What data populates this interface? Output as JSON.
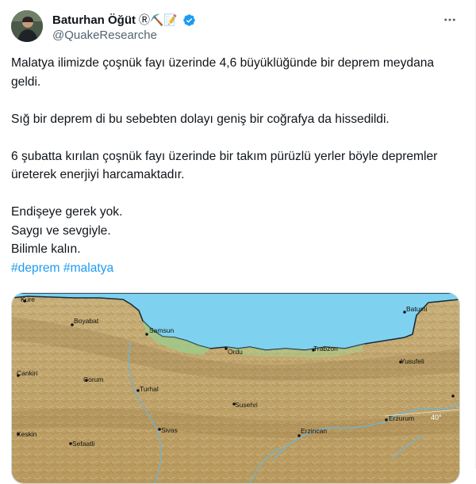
{
  "author": {
    "name": "Baturhan Öğüt",
    "name_badges": "Ⓡ⛏️📝",
    "handle": "@QuakeResearche",
    "verified": true,
    "verified_color": "#1d9bf0"
  },
  "menu_icon": "more-horizontal-icon",
  "tweet": {
    "line1": "Malatya ilimizde çoşnük fayı üzerinde 4,6 büyüklüğünde bir deprem meydana geldi.",
    "line2": "Sığ bir deprem di bu sebebten dolayı geniş bir coğrafya da hissedildi.",
    "line3": "6 şubatta kırılan çoşnük fayı üzerinde bir takım pürüzlü yerler böyle depremler üreterek enerjiyi harcamaktadır.",
    "line4": "Endişeye gerek yok.",
    "line5": "Saygı ve sevgiyle.",
    "line6": "Bilimle kalın.",
    "hashtags": [
      "#deprem",
      "#malatya"
    ],
    "link_color": "#1d9bf0"
  },
  "map": {
    "labels": {
      "kure": "Kure",
      "boyabat": "Boyabat",
      "samsun": "Samsun",
      "ordu": "Ordu",
      "trabzon": "Trabzon",
      "batumi": "Batumi",
      "cankiri": "Cankiri",
      "corum": "Corum",
      "turhal": "Turhal",
      "yusufeli": "Yusufeli",
      "susehri": "Susehri",
      "erzurum": "Erzurum",
      "keskin": "Keskin",
      "sivas": "Sivas",
      "erzincan": "Erzincan",
      "sefaatli": "Sefaatli",
      "lat": "40°"
    },
    "colors": {
      "sea": "#7fd2ef",
      "land": "#c9ad6e",
      "coast": "#9ccc8a"
    }
  }
}
